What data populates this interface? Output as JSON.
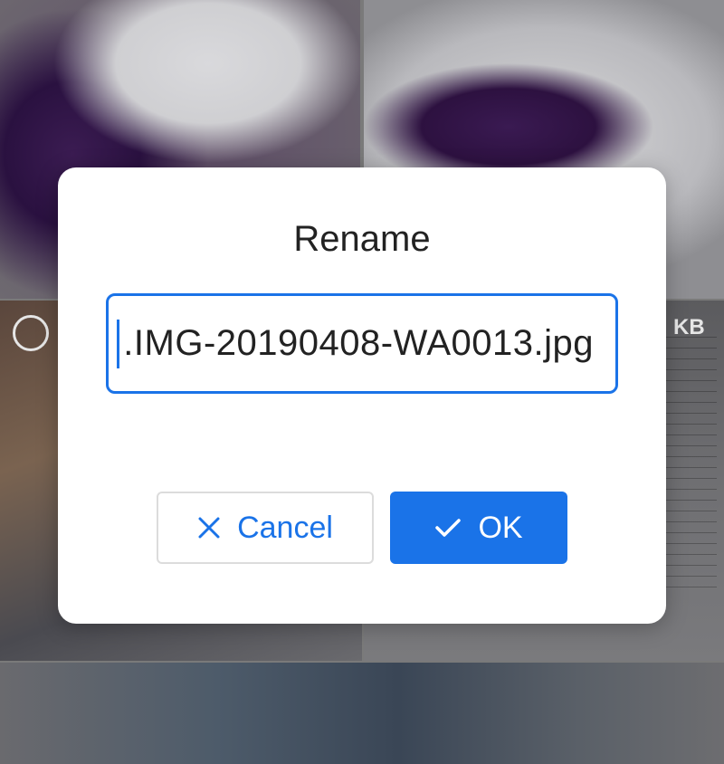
{
  "background": {
    "size_badge": "KB"
  },
  "dialog": {
    "title": "Rename",
    "filename_value": ".IMG-20190408-WA0013.jpg",
    "cancel_label": "Cancel",
    "cancel_icon": "close-icon",
    "ok_label": "OK",
    "ok_icon": "check-icon"
  },
  "colors": {
    "accent": "#1a73e8",
    "dialog_bg": "#ffffff",
    "text": "#222222"
  }
}
